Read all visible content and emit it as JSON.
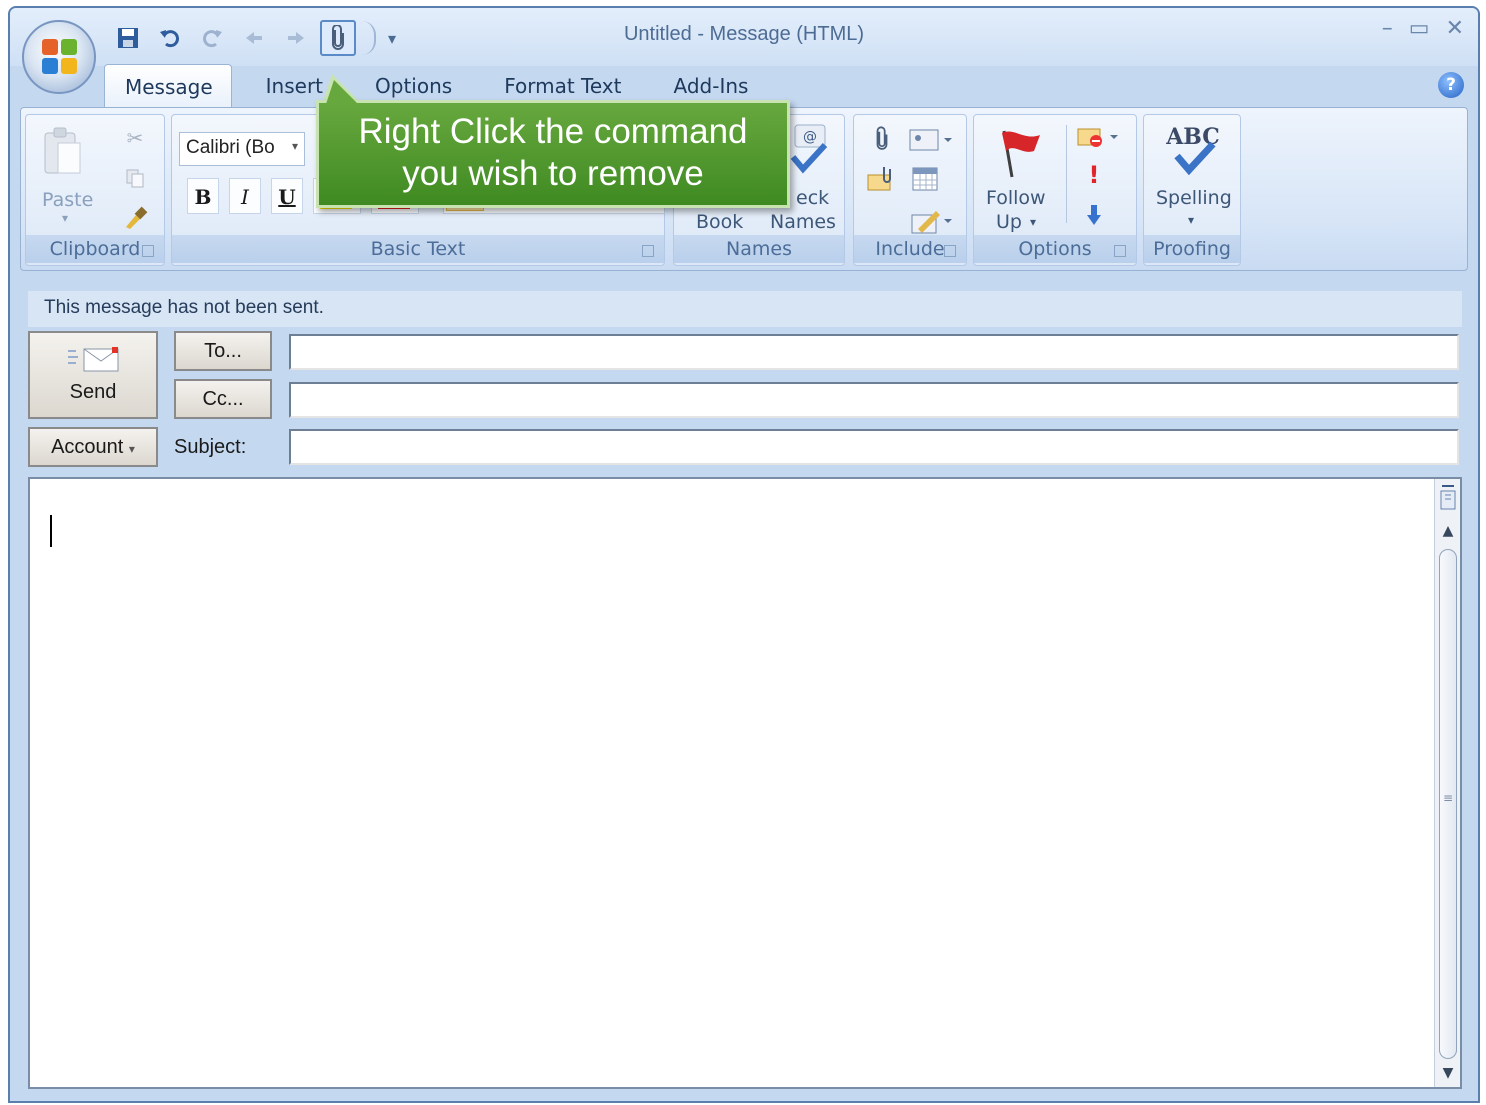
{
  "window": {
    "title": "Untitled - Message (HTML)",
    "controls": [
      "–",
      "▭",
      "✕"
    ]
  },
  "quick_access": {
    "items": [
      "save-icon",
      "undo-icon",
      "redo-icon",
      "previous-item-icon",
      "next-item-icon",
      "attach-file-icon",
      "customize-toolbar-icon"
    ],
    "selected": "attach-file-icon"
  },
  "tabs": [
    "Message",
    "Insert",
    "Options",
    "Format Text",
    "Add-Ins"
  ],
  "help_label": "?",
  "ribbon": {
    "clipboard": {
      "label": "Clipboard",
      "paste": "Paste"
    },
    "basic_text": {
      "label": "Basic Text",
      "font": "Calibri (Bo",
      "bold": "B",
      "italic": "I",
      "underline": "U"
    },
    "names": {
      "label": "Names",
      "book": "Book",
      "check_names_line1": "eck",
      "check_names_line2": "Names"
    },
    "include": {
      "label": "Include"
    },
    "options": {
      "label": "Options",
      "follow_up_line1": "Follow",
      "follow_up_line2": "Up"
    },
    "proofing": {
      "label": "Proofing",
      "spelling": "Spelling",
      "abc": "ABC"
    }
  },
  "callout": {
    "line1": "Right Click the command",
    "line2": "you wish to remove"
  },
  "form": {
    "info": "This message has not been sent.",
    "send": "Send",
    "to": "To...",
    "cc": "Cc...",
    "account": "Account",
    "subject_label": "Subject:",
    "to_value": "",
    "cc_value": "",
    "subject_value": ""
  },
  "colors": {
    "accent": "#3f8a22",
    "ribbon": "#d7e5f7",
    "frame": "#c4d8f0"
  }
}
